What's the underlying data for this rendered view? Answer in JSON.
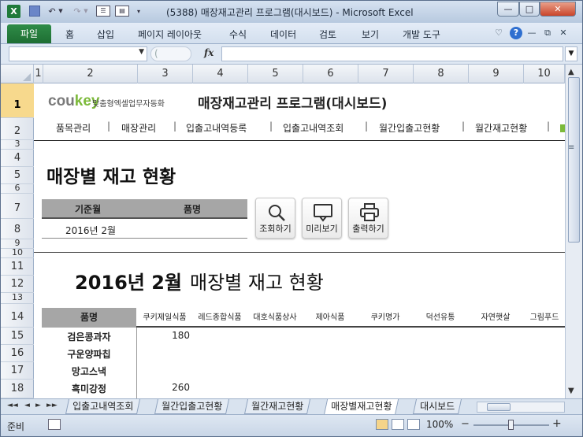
{
  "window": {
    "title": "(5388) 매장재고관리 프로그램(대시보드)  -  Microsoft Excel",
    "quick_access": [
      "save-icon",
      "undo-icon",
      "redo-icon",
      "form-icon",
      "print-preview-icon",
      "customize-icon"
    ],
    "controls": {
      "minimize": "—",
      "maximize": "□",
      "close": "✕"
    }
  },
  "ribbon": {
    "file_tab": "파일",
    "tabs": [
      "홈",
      "삽입",
      "페이지 레이아웃",
      "수식",
      "데이터",
      "검토",
      "보기",
      "개발 도구"
    ],
    "right_icons": [
      "collapse-ribbon-icon",
      "help-icon",
      "minimize-workbook-icon",
      "restore-workbook-icon",
      "close-workbook-icon"
    ],
    "help_glyph": "?"
  },
  "formula_bar": {
    "name_box": "",
    "fx_label": "fx",
    "formula": ""
  },
  "columns": [
    "1",
    "2",
    "3",
    "4",
    "5",
    "6",
    "7",
    "8",
    "9",
    "10"
  ],
  "rows": [
    "1",
    "2",
    "3",
    "4",
    "5",
    "6",
    "7",
    "8",
    "9",
    "10",
    "11",
    "12",
    "13",
    "14",
    "15",
    "16",
    "17",
    "18"
  ],
  "selected_row": "1",
  "sheet": {
    "logo": {
      "part1": "cou",
      "part2": "key",
      "tagline": "맞춤형엑셀업무자동화"
    },
    "app_title": "매장재고관리 프로그램(대시보드)",
    "nav": [
      "품목관리",
      "매장관리",
      "입출고내역등록",
      "입출고내역조회",
      "월간입출고현황",
      "월간재고현황"
    ],
    "nav_separator": "|",
    "section_title": "매장별 재고 현황",
    "filter": {
      "headers": [
        "기준월",
        "품명"
      ],
      "month_value": "2016년 2월",
      "item_value": ""
    },
    "buttons": [
      {
        "label": "조회하기",
        "icon": "search-icon"
      },
      {
        "label": "미리보기",
        "icon": "preview-monitor-icon"
      },
      {
        "label": "출력하기",
        "icon": "printer-icon"
      }
    ],
    "report": {
      "title_bold": "2016년 2월",
      "title_rest": "매장별 재고 현황"
    },
    "table": {
      "name_header": "품명",
      "store_headers": [
        "쿠키제일식품",
        "레드종합식품",
        "대호식품상사",
        "제아식품",
        "쿠키명가",
        "덕선유통",
        "자연햇살",
        "그림푸드"
      ],
      "rows": [
        {
          "name": "검은콩과자",
          "first_value": "180"
        },
        {
          "name": "구운양파칩",
          "first_value": ""
        },
        {
          "name": "망고스낵",
          "first_value": ""
        },
        {
          "name": "흑미강정",
          "first_value": "260"
        }
      ]
    }
  },
  "sheet_tabs": {
    "tabs": [
      "입출고내역조회",
      "월간입출고현황",
      "월간재고현황",
      "매장별재고현황",
      "대시보드"
    ],
    "active": "매장별재고현황",
    "nav_glyphs": [
      "◄◄",
      "◄",
      "►",
      "►►"
    ]
  },
  "status": {
    "ready": "준비",
    "zoom": "100%",
    "zoom_minus": "−",
    "zoom_plus": "+"
  }
}
